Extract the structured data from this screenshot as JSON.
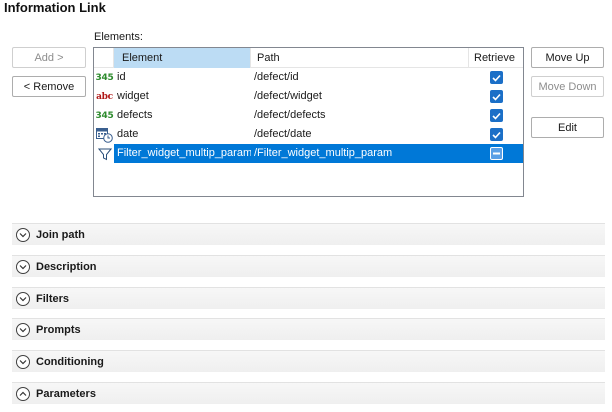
{
  "title": "Information Link",
  "elements_label": "Elements:",
  "buttons": {
    "add": "Add >",
    "remove": "< Remove",
    "move_up": "Move Up",
    "move_down": "Move Down",
    "edit": "Edit"
  },
  "grid": {
    "columns": [
      "Element",
      "Path",
      "Retrieve"
    ],
    "rows": [
      {
        "icon": "integer-icon",
        "icon_text": "345",
        "element": "id",
        "path": "/defect/id",
        "retrieve": true
      },
      {
        "icon": "string-icon",
        "icon_text": "abc",
        "element": "widget",
        "path": "/defect/widget",
        "retrieve": true
      },
      {
        "icon": "integer-icon",
        "icon_text": "345",
        "element": "defects",
        "path": "/defect/defects",
        "retrieve": true
      },
      {
        "icon": "date-icon",
        "icon_text": "",
        "element": "date",
        "path": "/defect/date",
        "retrieve": true
      },
      {
        "icon": "filter-icon",
        "icon_text": "",
        "element": "Filter_widget_multip_param",
        "path": "/Filter_widget_multip_param",
        "retrieve": "indeterminate",
        "selected": true
      }
    ]
  },
  "sections": [
    {
      "title": "Join path",
      "expanded": false
    },
    {
      "title": "Description",
      "expanded": false
    },
    {
      "title": "Filters",
      "expanded": false
    },
    {
      "title": "Prompts",
      "expanded": false
    },
    {
      "title": "Conditioning",
      "expanded": false
    },
    {
      "title": "Parameters",
      "expanded": true
    }
  ],
  "colors": {
    "selection": "#0078d7",
    "sorted_header": "#bcdcf4",
    "checkbox": "#1b6fc7"
  }
}
